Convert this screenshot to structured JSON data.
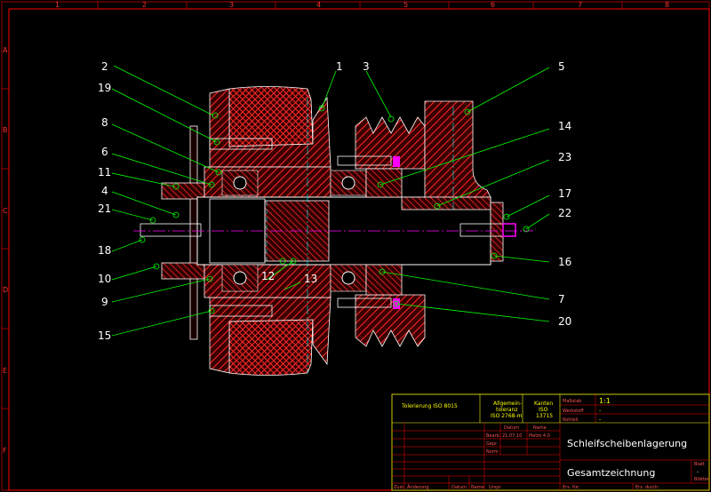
{
  "border": {
    "columns": [
      "1",
      "2",
      "3",
      "4",
      "5",
      "6",
      "7",
      "8"
    ],
    "rows": [
      "A",
      "B",
      "C",
      "D",
      "E",
      "F"
    ]
  },
  "labels": [
    "2",
    "1",
    "3",
    "5",
    "19",
    "8",
    "14",
    "6",
    "23",
    "11",
    "4",
    "17",
    "21",
    "22",
    "18",
    "16",
    "10",
    "12",
    "13",
    "9",
    "7",
    "20",
    "15"
  ],
  "title_block": {
    "tolerances": "Tolerierung ISO 8015",
    "general_tol_1": "Allgemein-",
    "general_tol_2": "toleranz",
    "general_tol_3": "ISO 2768-m",
    "edges_1": "Kanten",
    "edges_2": "ISO",
    "edges_3": "13715",
    "scale_label": "Maßstab",
    "scale_value": "1:1",
    "material_label": "Werkstoff",
    "material_value": "-",
    "semi_label": "Rohteil",
    "semi_value": "-",
    "date_header": "Datum",
    "name_header": "Name",
    "drawn_label": "Bearb.",
    "drawn_date": "21.07.10",
    "drawn_name": "Pietro 4.0",
    "checked_label": "Gepr.",
    "norm_label": "Norm",
    "title": "Schleifscheibenlagerung",
    "subtitle": "Gesamtzeichnung",
    "sheet_label": "Blatt",
    "sheet_value": "-",
    "sheets_label": "Blätter",
    "footer": [
      "Zust.",
      "Änderung",
      "Datum",
      "Name",
      "Urspr.",
      "Ers. für:",
      "Ers. durch:"
    ]
  },
  "colors": {
    "border": "#ff0000",
    "section": "#ff2a2a",
    "outline": "#ffffff",
    "leader": "#00ff00",
    "centerline": "#ff00ff",
    "hidden": "#00ffff",
    "title_yellow": "#ffff00"
  }
}
